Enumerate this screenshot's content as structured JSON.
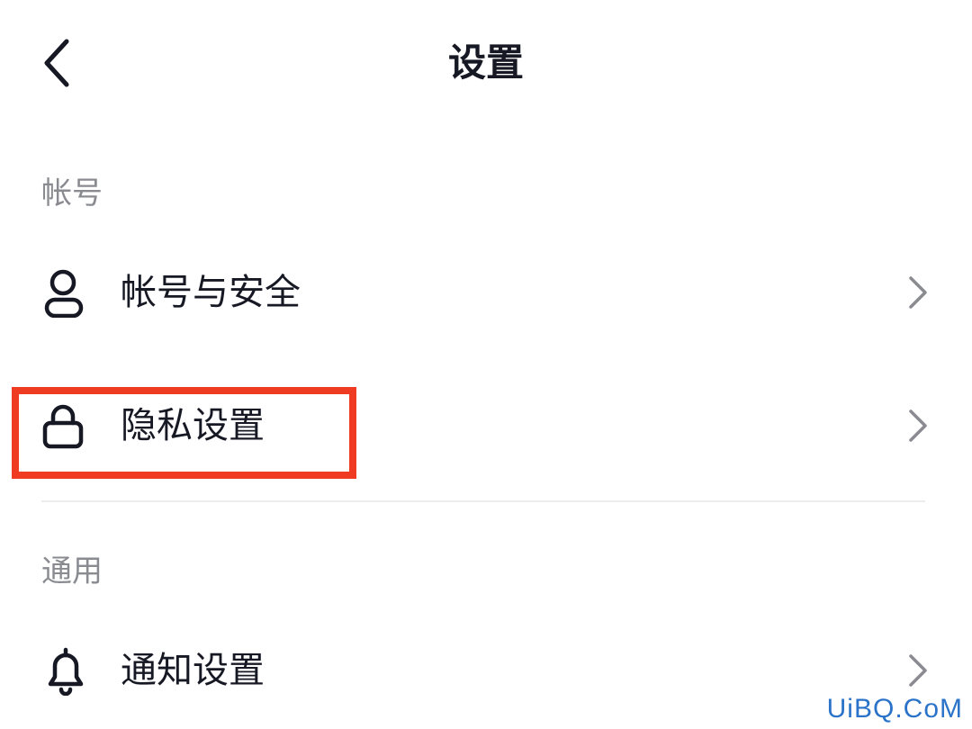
{
  "header": {
    "title": "设置",
    "back_icon": "chevron-left-icon"
  },
  "sections": [
    {
      "label": "帐号",
      "items": [
        {
          "label": "帐号与安全",
          "icon": "user-icon"
        },
        {
          "label": "隐私设置",
          "icon": "lock-icon",
          "highlighted": true
        }
      ]
    },
    {
      "label": "通用",
      "items": [
        {
          "label": "通知设置",
          "icon": "bell-icon"
        }
      ]
    }
  ],
  "row_chevron_icon": "chevron-right-icon",
  "highlight_color": "#ee3b22",
  "watermark": "UiBQ.CoM"
}
